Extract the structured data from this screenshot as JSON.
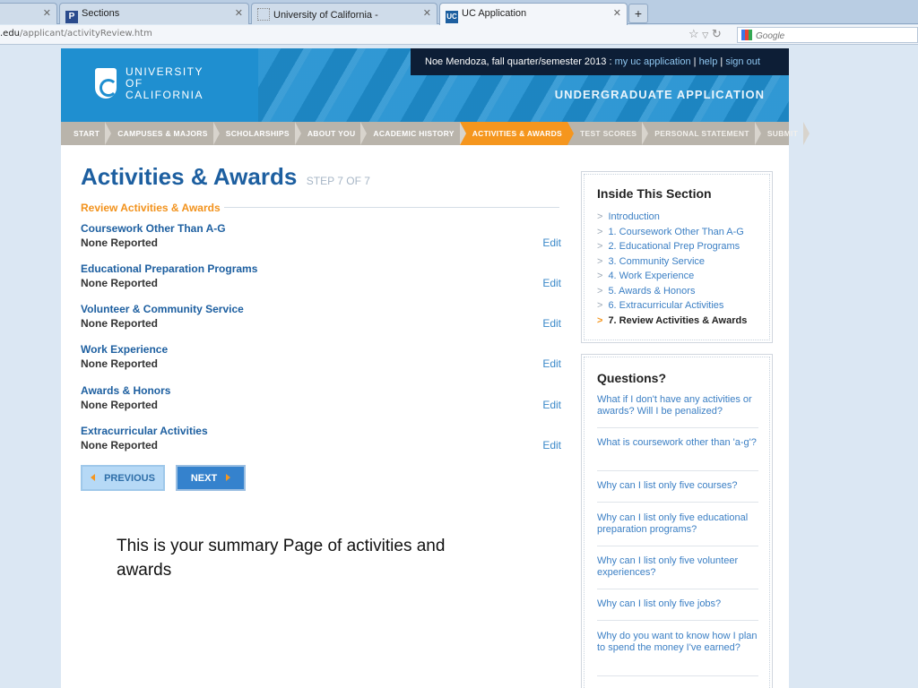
{
  "browser": {
    "tabs": [
      {
        "label": "Sections",
        "favicon": "P"
      },
      {
        "label": "University of California -",
        "favicon": ""
      },
      {
        "label": "UC Application",
        "favicon": "UC"
      }
    ],
    "url_domain": ".edu",
    "url_path": "/applicant/activityReview.htm",
    "search_engine": "Google"
  },
  "header": {
    "logo_line1": "UNIVERSITY",
    "logo_line2": "OF",
    "logo_line3": "CALIFORNIA",
    "user_text": "Noe Mendoza, fall quarter/semester 2013 :",
    "link_my_app": "my uc application",
    "link_help": "help",
    "link_signout": "sign out",
    "app_title": "UNDERGRADUATE APPLICATION"
  },
  "steps": [
    "START",
    "CAMPUSES & MAJORS",
    "SCHOLARSHIPS",
    "ABOUT YOU",
    "ACADEMIC HISTORY",
    "ACTIVITIES & AWARDS",
    "TEST SCORES",
    "PERSONAL STATEMENT",
    "SUBMIT"
  ],
  "main": {
    "title": "Activities & Awards",
    "step_of": "STEP 7 OF 7",
    "review_heading": "Review Activities & Awards",
    "activities": [
      {
        "title": "Coursework Other Than A-G",
        "value": "None Reported",
        "edit": "Edit"
      },
      {
        "title": "Educational Preparation Programs",
        "value": "None Reported",
        "edit": "Edit"
      },
      {
        "title": "Volunteer & Community Service",
        "value": "None Reported",
        "edit": "Edit"
      },
      {
        "title": "Work Experience",
        "value": "None Reported",
        "edit": "Edit"
      },
      {
        "title": "Awards & Honors",
        "value": "None Reported",
        "edit": "Edit"
      },
      {
        "title": "Extracurricular Activities",
        "value": "None Reported",
        "edit": "Edit"
      }
    ],
    "prev_label": "PREVIOUS",
    "next_label": "NEXT"
  },
  "annotation": "This is your summary Page of activities and awards",
  "inside_section": {
    "title": "Inside This Section",
    "items": [
      "Introduction",
      "1. Coursework Other Than A-G",
      "2. Educational Prep Programs",
      "3. Community Service",
      "4. Work Experience",
      "5. Awards & Honors",
      "6. Extracurricular Activities",
      "7. Review Activities & Awards"
    ]
  },
  "questions": {
    "title": "Questions?",
    "items": [
      "What if I don't have any activities or awards? Will I be penalized?",
      "What is coursework other than 'a-g'?",
      "Why can I list only five courses?",
      "Why can I list only five educational preparation programs?",
      "Why can I list only five volunteer experiences?",
      "Why can I list only five jobs?",
      "Why do you want to know how I plan to spend the money I've earned?"
    ]
  },
  "colors": {
    "accent_orange": "#f5961e",
    "uc_blue": "#1d5fa0",
    "banner_blue": "#1f8fd0"
  }
}
